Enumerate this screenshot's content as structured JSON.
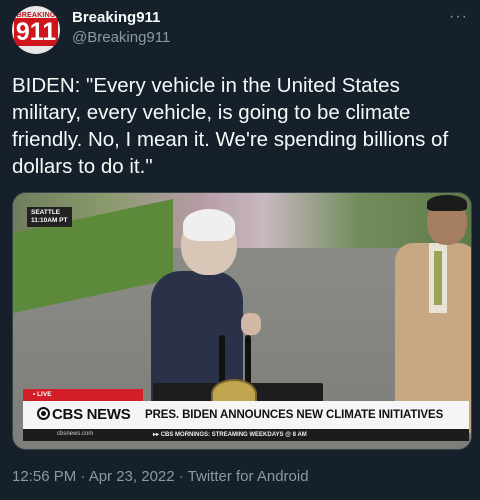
{
  "tweet": {
    "display_name": "Breaking911",
    "handle": "@Breaking911",
    "more_icon": "more-horizontal-icon",
    "avatar": {
      "top_text": "BREAKING",
      "number": "911",
      "colors": {
        "red": "#d0141b",
        "bg": "#e8e8e8"
      }
    },
    "text": "BIDEN: \"Every vehicle in the United States military, every vehicle, is going to be climate friendly. No, I mean it. We're spending billions of dollars to do it.\"",
    "timestamp": "12:56 PM · Apr 23, 2022 · Twitter for Android"
  },
  "media": {
    "locator_line1": "SEATTLE",
    "locator_line2": "11:10AM PT",
    "live_label": "• LIVE",
    "network": "CBS NEWS",
    "headline": "PRES. BIDEN ANNOUNCES NEW CLIMATE INITIATIVES",
    "ticker_url": "cbsnews.com",
    "ticker_text": "▸▸ CBS MORNINGS: STREAMING WEEKDAYS @ 8 AM"
  },
  "colors": {
    "background": "#15202b",
    "primary_text": "#f7f9f9",
    "secondary_text": "#8b98a5",
    "cbs_red": "#d31f29"
  }
}
